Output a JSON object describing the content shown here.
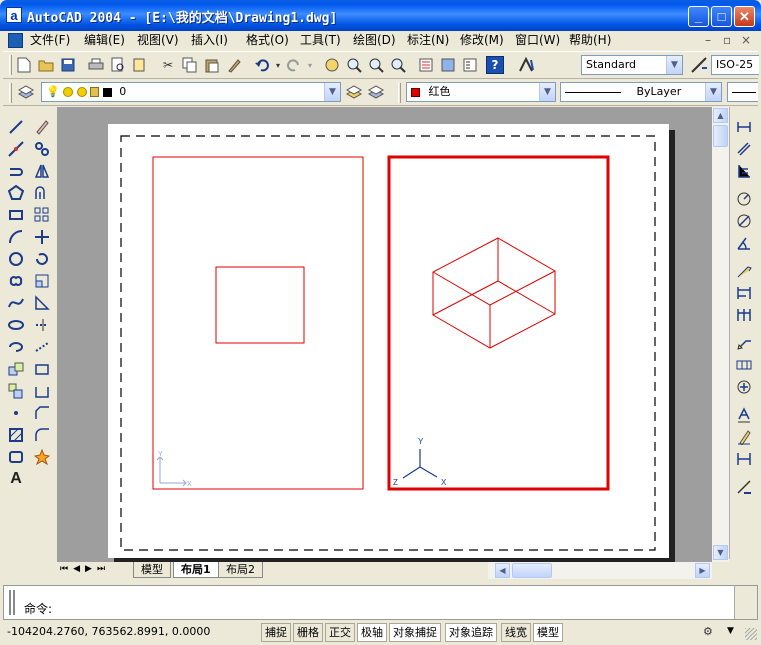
{
  "window": {
    "app_icon": "a",
    "title": "AutoCAD 2004 - [E:\\我的文档\\Drawing1.dwg]",
    "min_icon": "minimize-icon",
    "max_icon": "maximize-icon",
    "close_icon": "close-icon"
  },
  "menu": {
    "items": [
      "文件(F)",
      "编辑(E)",
      "视图(V)",
      "插入(I)",
      "格式(O)",
      "工具(T)",
      "绘图(D)",
      "标注(N)",
      "修改(M)",
      "窗口(W)",
      "帮助(H)"
    ],
    "doc_controls": [
      "–",
      "▫",
      "×"
    ]
  },
  "standard_toolbar": {
    "text_style": "Standard",
    "dim_style": "ISO-25"
  },
  "layers_toolbar": {
    "layer": "0",
    "color": "红色",
    "color_swatch": "#E00000",
    "linetype": "ByLayer"
  },
  "layout_tabs": [
    "模型",
    "布局1",
    "布局2"
  ],
  "active_tab": "布局1",
  "command": {
    "prompt": "命令:"
  },
  "status": {
    "coordinates": "-104204.2760, 763562.8991, 0.0000",
    "toggles": [
      "捕捉",
      "栅格",
      "正交",
      "极轴",
      "对象捕捉",
      "对象追踪",
      "线宽",
      "模型"
    ]
  },
  "drawing": {
    "line_color": "#E00000",
    "ucs_labels": {
      "x": "X",
      "y": "Y",
      "z": "Z"
    }
  }
}
